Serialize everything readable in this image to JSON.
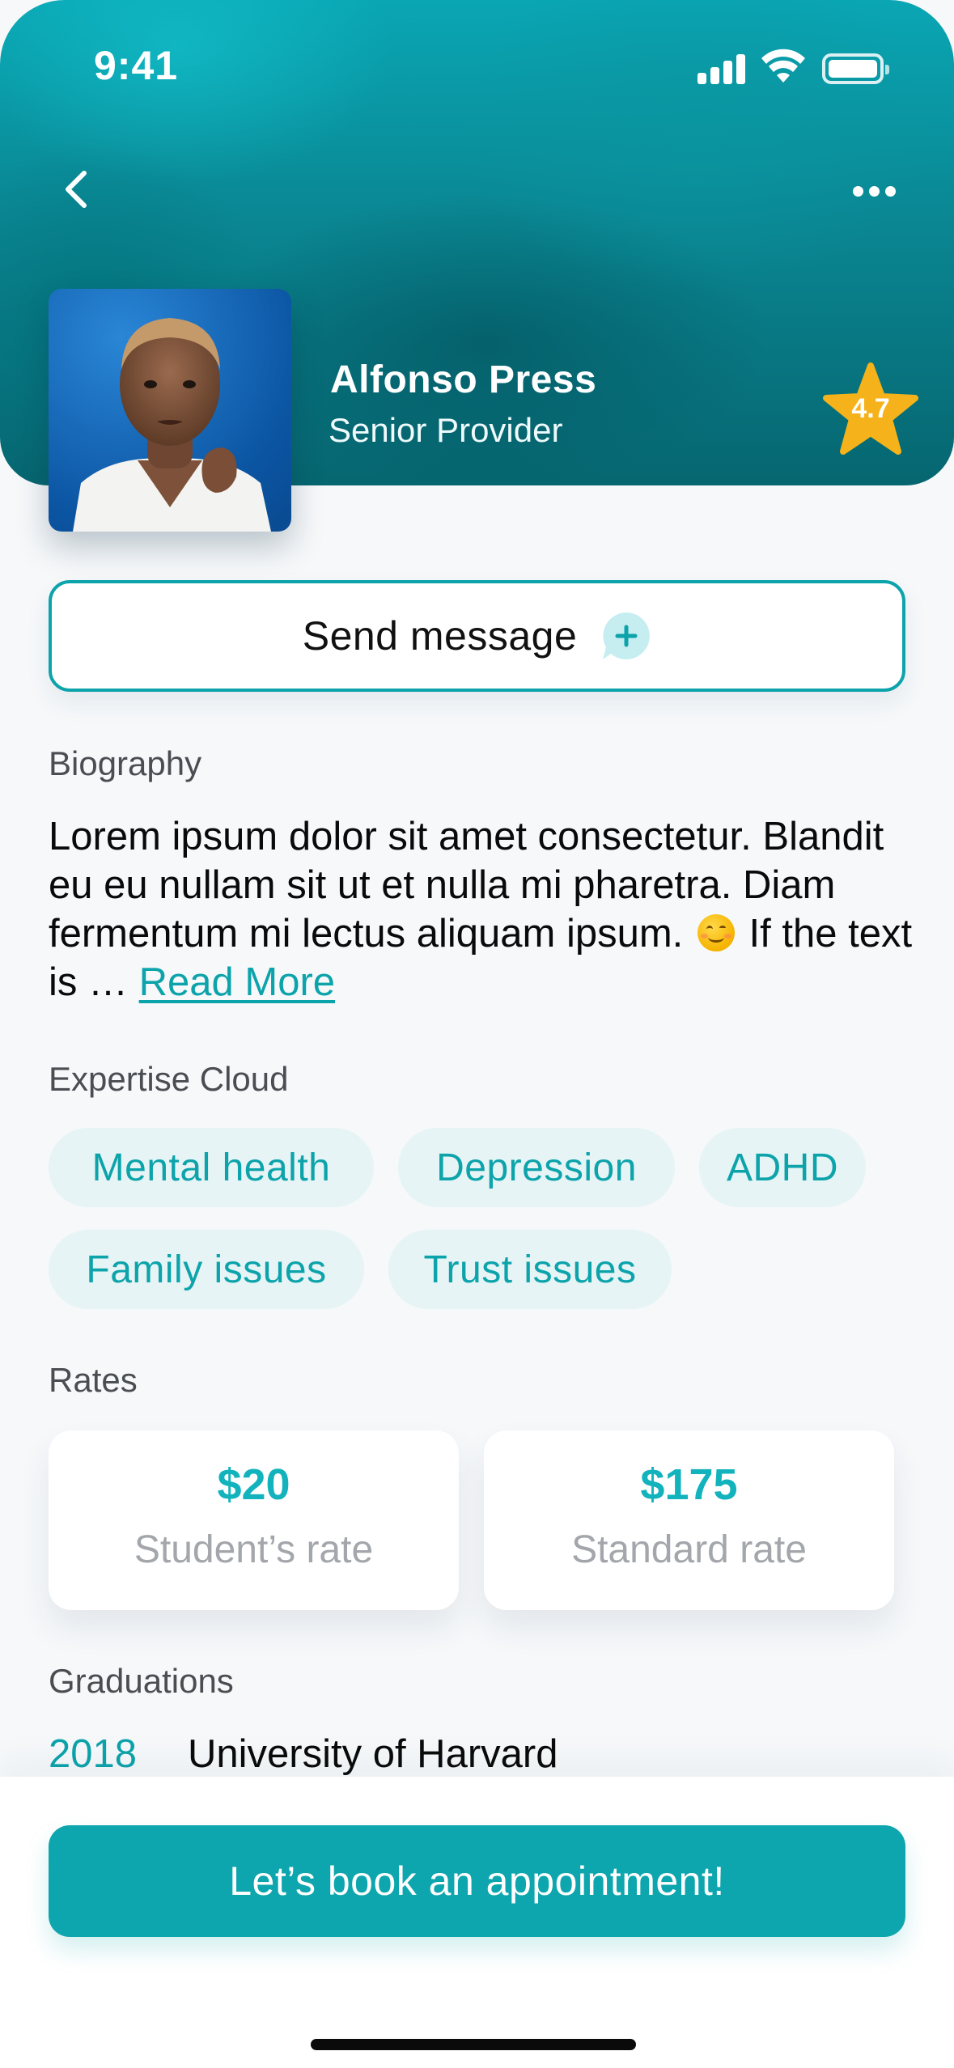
{
  "status_bar": {
    "time": "9:41"
  },
  "header": {
    "name": "Alfonso Press",
    "role": "Senior Provider",
    "rating": "4.7"
  },
  "actions": {
    "send_message": "Send message"
  },
  "biography": {
    "title": "Biography",
    "text_before_emoji": "Lorem ipsum dolor sit amet consectetur. Blandit eu eu nullam sit ut et nulla mi pharetra. Diam fermentum mi lectus aliquam ipsum.",
    "emoji_icon": "smiling-face-emoji",
    "text_after_emoji": "If the text is …",
    "read_more": "Read More"
  },
  "expertise": {
    "title": "Expertise Cloud",
    "tags": [
      "Mental health",
      "Depression",
      "ADHD",
      "Family issues",
      "Trust issues"
    ]
  },
  "rates": {
    "title": "Rates",
    "items": [
      {
        "amount": "$20",
        "label": "Student’s rate"
      },
      {
        "amount": "$175",
        "label": "Standard rate"
      }
    ]
  },
  "graduations": {
    "title": "Graduations",
    "items": [
      {
        "year": "2018",
        "school": "University of Harvard"
      }
    ]
  },
  "cta": {
    "book_label": "Let’s book an appointment!"
  },
  "colors": {
    "accent": "#0ca3ab",
    "chip_bg": "#e6f4f5",
    "star": "#f5b21a",
    "header_dark": "#066670"
  }
}
